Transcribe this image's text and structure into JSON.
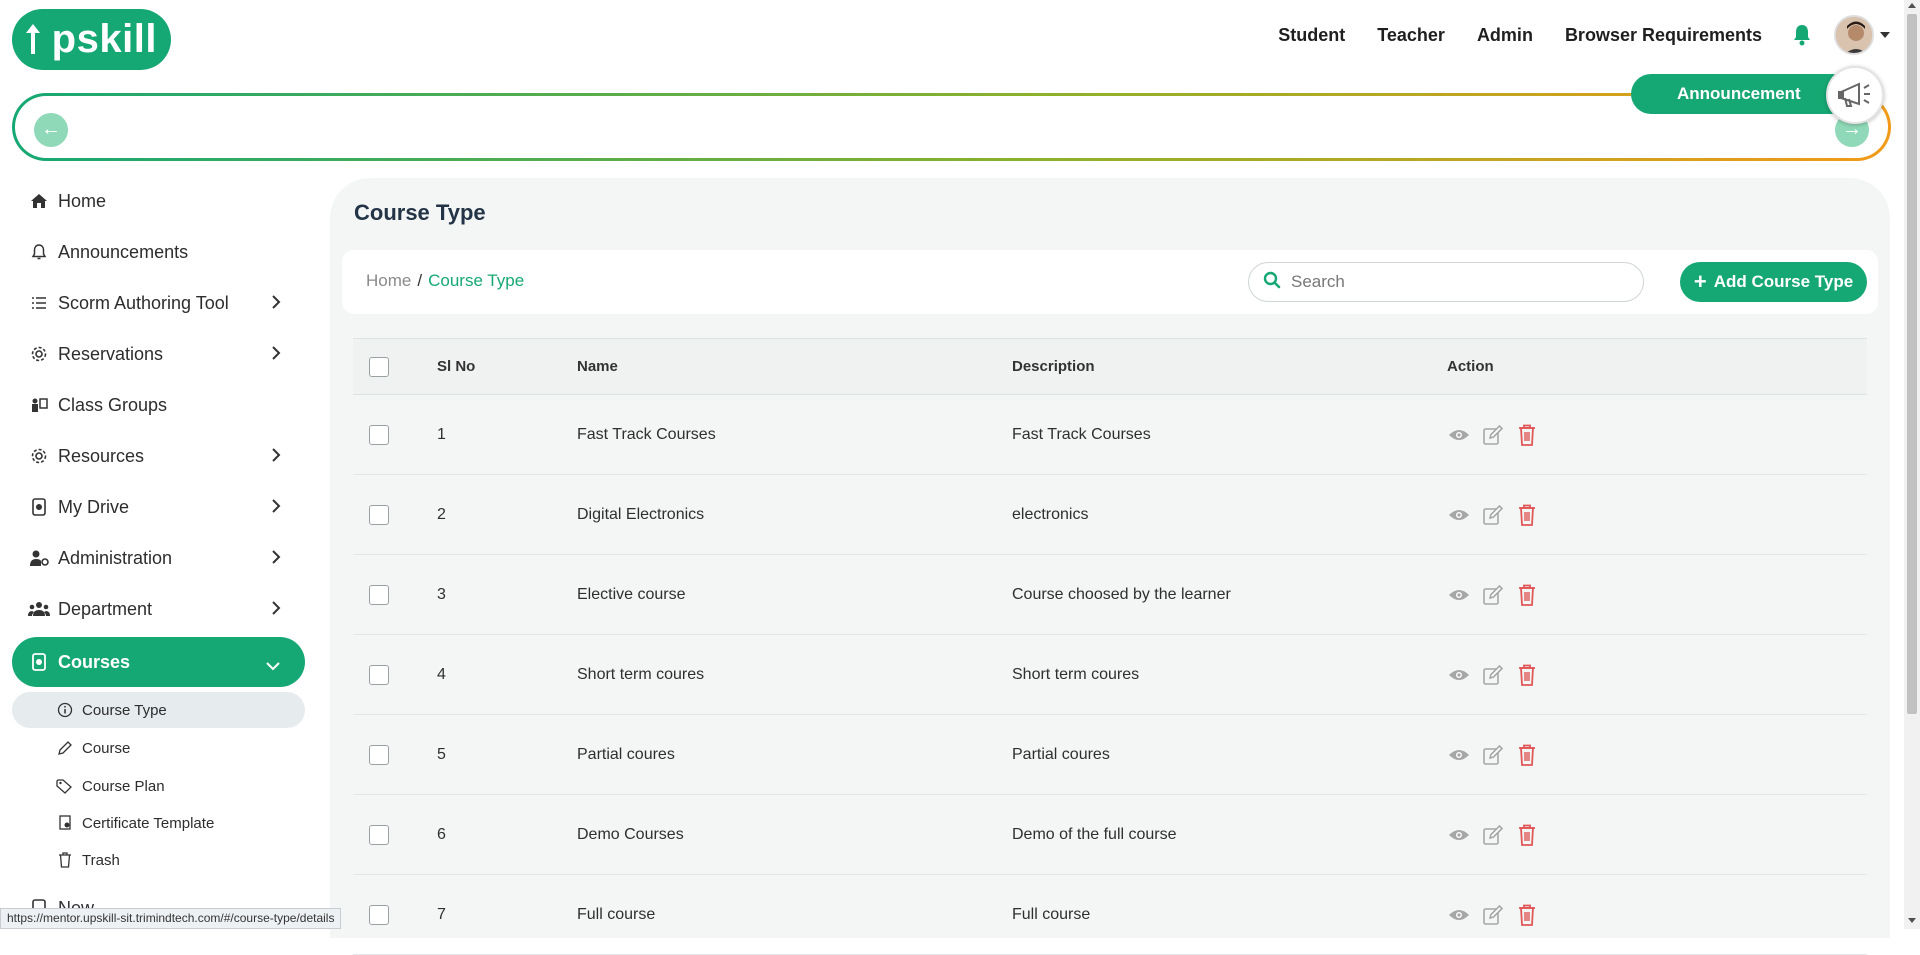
{
  "header": {
    "logo_text": "Upskill",
    "nav": [
      "Student",
      "Teacher",
      "Admin",
      "Browser Requirements"
    ]
  },
  "announcement": {
    "label": "Announcement"
  },
  "sidebar": {
    "items": [
      {
        "label": "Home",
        "icon": "home-icon",
        "chevron": false
      },
      {
        "label": "Announcements",
        "icon": "bell-icon",
        "chevron": false
      },
      {
        "label": "Scorm Authoring Tool",
        "icon": "list-icon",
        "chevron": true
      },
      {
        "label": "Reservations",
        "icon": "gear-icon",
        "chevron": true
      },
      {
        "label": "Class Groups",
        "icon": "class-groups-icon",
        "chevron": false
      },
      {
        "label": "Resources",
        "icon": "gear-icon",
        "chevron": true
      },
      {
        "label": "My Drive",
        "icon": "drive-icon",
        "chevron": true
      },
      {
        "label": "Administration",
        "icon": "user-gear-icon",
        "chevron": true
      },
      {
        "label": "Department",
        "icon": "users-icon",
        "chevron": true
      },
      {
        "label": "Courses",
        "icon": "courses-icon",
        "chevron": true,
        "active": true
      }
    ],
    "sub_items": [
      {
        "label": "Course Type",
        "icon": "info-circle-icon",
        "active": true
      },
      {
        "label": "Course",
        "icon": "pencil-icon"
      },
      {
        "label": "Course Plan",
        "icon": "tag-icon"
      },
      {
        "label": "Certificate Template",
        "icon": "certificate-icon"
      },
      {
        "label": "Trash",
        "icon": "trash-icon"
      }
    ],
    "partial_item": "New"
  },
  "main": {
    "title": "Course Type",
    "breadcrumb": {
      "home": "Home",
      "sep": "/",
      "current": "Course Type"
    },
    "search_placeholder": "Search",
    "add_button": "Add Course Type",
    "table": {
      "headers": {
        "sl": "Sl No",
        "name": "Name",
        "description": "Description",
        "action": "Action"
      },
      "rows": [
        {
          "sl": "1",
          "name": "Fast Track Courses",
          "description": "Fast Track Courses"
        },
        {
          "sl": "2",
          "name": "Digital Electronics",
          "description": "electronics"
        },
        {
          "sl": "3",
          "name": "Elective course",
          "description": "Course choosed by the learner"
        },
        {
          "sl": "4",
          "name": "Short term coures",
          "description": "Short term coures"
        },
        {
          "sl": "5",
          "name": "Partial coures",
          "description": "Partial coures"
        },
        {
          "sl": "6",
          "name": "Demo Courses",
          "description": "Demo of the full course"
        },
        {
          "sl": "7",
          "name": "Full course",
          "description": "Full course"
        }
      ]
    }
  },
  "status_url": "https://mentor.upskill-sit.trimindtech.com/#/course-type/details",
  "colors": {
    "brand": "#16a874",
    "danger": "#e05858",
    "muted_icon": "#9a9a9a"
  }
}
